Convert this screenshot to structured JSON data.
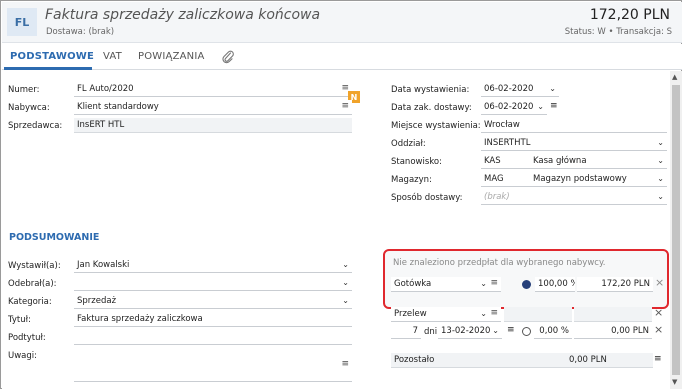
{
  "header": {
    "badge": "FL",
    "title": "Faktura sprzedaży zaliczkowa końcowa",
    "subtitle": "Dostawa: (brak)",
    "amount": "172,20 PLN",
    "status": "Status: W • Transakcja: S"
  },
  "tabs": [
    "PODSTAWOWE",
    "VAT",
    "POWIĄZANIA"
  ],
  "left": {
    "numer_label": "Numer:",
    "numer_value": "FL Auto/2020",
    "nabywca_label": "Nabywca:",
    "nabywca_value": "Klient standardowy",
    "sprzedawca_label": "Sprzedawca:",
    "sprzedawca_value": "InsERT HTL",
    "n_badge": "N"
  },
  "right": {
    "data_wyst_label": "Data wystawienia:",
    "data_wyst_value": "06-02-2020",
    "data_dost_label": "Data zak. dostawy:",
    "data_dost_value": "06-02-2020",
    "miejsce_label": "Miejsce wystawienia:",
    "miejsce_value": "Wrocław",
    "oddzial_label": "Oddział:",
    "oddzial_value": "INSERTHTL",
    "stanowisko_label": "Stanowisko:",
    "stanowisko_code": "KAS",
    "stanowisko_name": "Kasa główna",
    "magazyn_label": "Magazyn:",
    "magazyn_code": "MAG",
    "magazyn_name": "Magazyn podstawowy",
    "sposob_label": "Sposób dostawy:",
    "sposob_placeholder": "(brak)"
  },
  "summary": {
    "section_title": "PODSUMOWANIE",
    "wystawil_label": "Wystawił(a):",
    "wystawil_value": "Jan Kowalski",
    "odebral_label": "Odebrał(a):",
    "odebral_value": "",
    "kategoria_label": "Kategoria:",
    "kategoria_value": "Sprzedaż",
    "tytul_label": "Tytuł:",
    "tytul_value": "Faktura sprzedaży zaliczkowa",
    "podtytul_label": "Podtytuł:",
    "podtytul_value": "",
    "uwagi_label": "Uwagi:",
    "uwagi_value": ""
  },
  "payments": {
    "info": "Nie znaleziono przedpłat dla wybranego nabywcy.",
    "row1_method": "Gotówka",
    "row1_percent": "100,00 %",
    "row1_amount": "172,20 PLN",
    "row2_method": "Przelew",
    "row2_days": "7",
    "row2_days_unit": "dni",
    "row2_date": "13-02-2020",
    "row2_percent": "0,00 %",
    "row2_amount": "0,00 PLN",
    "pozostalo_label": "Pozostało",
    "pozostalo_value": "0,00 PLN"
  },
  "colors": {
    "accent": "#2d6bb0",
    "highlight": "#e0282e",
    "badge": "#f0a32a",
    "radio_selected": "#27407a"
  },
  "icons": [
    "paperclip-icon",
    "menu-lines-icon",
    "chevron-down-icon",
    "close-icon"
  ]
}
